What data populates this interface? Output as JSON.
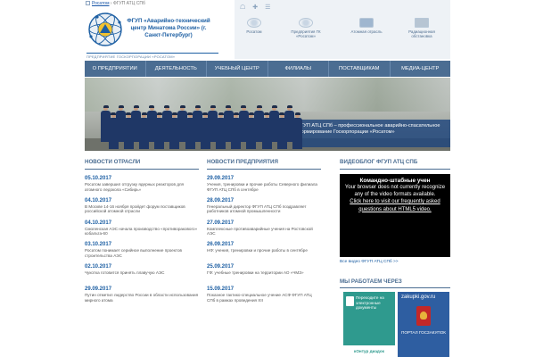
{
  "breadcrumb": {
    "home": "Росатом",
    "current": "ФГУП АТЦ СПб"
  },
  "org": {
    "name": "ФГУП «Аварийно-технический центр Минатома России» (г. Санкт-Петербург)",
    "subtitle": "ПРЕДПРИЯТИЕ ГОСКОРПОРАЦИИ «РОСАТОМ»"
  },
  "toolbar": {
    "home_icon": "☖",
    "plus_icon": "✚",
    "menu_icon": "☰"
  },
  "partners": [
    {
      "label": "Росатом",
      "icon": "rosatom-logo"
    },
    {
      "label": "Предприятия ГК «Росатом»",
      "icon": "enterprises-icon"
    },
    {
      "label": "Атомная отрасль",
      "icon": "industry-icon"
    },
    {
      "label": "Радиационная обстановка",
      "icon": "map-icon"
    }
  ],
  "nav": [
    "О ПРЕДПРИЯТИИ",
    "ДЕЯТЕЛЬНОСТЬ",
    "УЧЕБНЫЙ ЦЕНТР",
    "ФИЛИАЛЫ",
    "ПОСТАВЩИКАМ",
    "МЕДИА-ЦЕНТР"
  ],
  "hero": {
    "caption": "ФГУП АТЦ СПб – профессиональное аварийно-спасательное формирование Госкорпорации «Росатом»"
  },
  "industry_news": {
    "heading": "НОВОСТИ ОТРАСЛИ",
    "items": [
      {
        "date": "05.10.2017",
        "text": "Росатом завершил отгрузку ядерных реакторов для атомного ледокола «Сибирь»"
      },
      {
        "date": "04.10.2017",
        "text": "В Москве 14-16 ноября пройдет форум поставщиков российской атомной отрасли"
      },
      {
        "date": "04.10.2017",
        "text": "Смоленская АЭС начала производство «противоракового» кобальта-60"
      },
      {
        "date": "03.10.2017",
        "text": "Росатом понимает серийное выполнение проектов строительства АЭС"
      },
      {
        "date": "02.10.2017",
        "text": "Чукотка готовится принять плавучую АЭС"
      },
      {
        "date": "29.09.2017",
        "text": "Путин отметил лидерство России в области использования мирного атома"
      }
    ]
  },
  "company_news": {
    "heading": "НОВОСТИ ПРЕДПРИЯТИЯ",
    "items": [
      {
        "date": "29.09.2017",
        "text": "Учения, тренировки и прочие работы Северного филиала ФГУП АТЦ СПб в сентябре"
      },
      {
        "date": "28.09.2017",
        "text": "Генеральный директор ФГУП АТЦ СПб поздравляет работников атомной промышленности"
      },
      {
        "date": "27.09.2017",
        "text": "Комплексные противоаварийные учения на Ростовской АЭС"
      },
      {
        "date": "26.09.2017",
        "text": "НФ: учения, тренировки и прочие работы в сентябре"
      },
      {
        "date": "25.09.2017",
        "text": "ГФ: учебные тренировки на территории АО «ЧМЗ»"
      },
      {
        "date": "15.09.2017",
        "text": "Показное тактико-специальное учение АСФ ФГУП АТЦ СПб в рамках проведения XII"
      }
    ]
  },
  "video": {
    "heading": "ВИДЕОБЛОГ ФГУП АТЦ СПБ",
    "title": "Командно-штабные учен",
    "msg1": "Your browser does not currently recognize any of the video formats available.",
    "link": "Click here to visit our frequently asked questions about HTML5 video.",
    "all_link": "Все видео ФГУП АТЦ СПб >>"
  },
  "banners": {
    "heading": "МЫ РАБОТАЕМ ЧЕРЕЗ",
    "edo_text": "Переходите на электронные документы",
    "edo_brand": "кОнтур диадок",
    "zak_site": "zakupki.gov.ru",
    "zak_label": "ПОРТАЛ ГОСЗАКУПОК"
  },
  "colors": {
    "accent": "#4b6d92",
    "link": "#1d5fa3",
    "caption_bg": "#1e467d",
    "edo": "#2f9a8e",
    "zak": "#2e5ea1"
  }
}
